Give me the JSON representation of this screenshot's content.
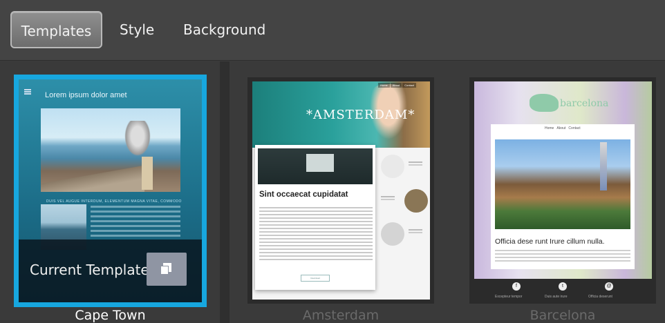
{
  "tabs": [
    {
      "label": "Templates",
      "active": true
    },
    {
      "label": "Style",
      "active": false
    },
    {
      "label": "Background",
      "active": false
    }
  ],
  "templates": [
    {
      "name": "Cape Town",
      "current": true,
      "current_label": "Current Template",
      "preview": {
        "title": "Lorem ipsum dolor amet",
        "caption": "DUIS VEL AUGUE INTERDUM, ELEMENTUM MAGNA VITAE, COMMODO"
      }
    },
    {
      "name": "Amsterdam",
      "current": false,
      "preview": {
        "nav": [
          "Home",
          "About",
          "Contact"
        ],
        "logo": "*AMSTERDAM*",
        "heading": "Sint occaecat cupidatat",
        "button": "Download"
      }
    },
    {
      "name": "Barcelona",
      "current": false,
      "preview": {
        "logo": "barcelona",
        "nav": [
          "Home",
          "About",
          "Contact"
        ],
        "heading": "Officia dese runt Irure cillum nulla.",
        "footer": [
          "Excepteur tempor",
          "Duis aute irure",
          "Officia deserunt"
        ],
        "footer_icons": [
          "f",
          "t",
          "@"
        ]
      }
    }
  ],
  "colors": {
    "accent": "#17a7df",
    "topbar": "#444444",
    "background": "#3a3a3a",
    "active_name": "#ffffff",
    "inactive_name": "#6a6a6a"
  }
}
